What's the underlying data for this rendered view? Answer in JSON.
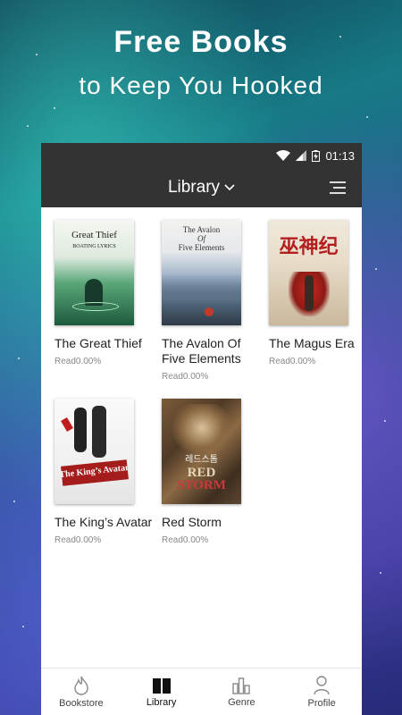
{
  "hero": {
    "title": "Free Books",
    "subtitle": "to Keep You Hooked"
  },
  "status_bar": {
    "time": "01:13",
    "icons": [
      "wifi-icon",
      "signal-icon",
      "battery-icon"
    ]
  },
  "app_bar": {
    "title": "Library",
    "dropdown_icon": "chevron-down-icon",
    "menu_icon": "menu-icon"
  },
  "books": [
    {
      "title": "The Great Thief",
      "progress": "Read0.00%",
      "cover_text": [
        "Great Thief",
        "BOATING LYRICS"
      ]
    },
    {
      "title": "The Avalon Of Five Elements",
      "progress": "Read0.00%",
      "cover_text": [
        "The Avalon",
        "Of",
        "Five Elements"
      ]
    },
    {
      "title": "The Magus Era",
      "progress": "Read0.00%",
      "cover_text": [
        "巫神纪"
      ]
    },
    {
      "title": "The King’s Avatar",
      "progress": "Read0.00%",
      "cover_text": [
        "The King’s Avatar"
      ]
    },
    {
      "title": "Red Storm",
      "progress": "Read0.00%",
      "cover_text": [
        "레드스톰",
        "RED",
        "STORM"
      ]
    }
  ],
  "bottom_nav": [
    {
      "label": "Bookstore",
      "icon": "flame-icon"
    },
    {
      "label": "Library",
      "icon": "book-icon",
      "active": true
    },
    {
      "label": "Genre",
      "icon": "bars-icon"
    },
    {
      "label": "Profile",
      "icon": "person-icon"
    }
  ],
  "colors": {
    "status_bar_bg": "#333333",
    "app_bar_bg": "#333333",
    "progress_text": "#888888"
  }
}
